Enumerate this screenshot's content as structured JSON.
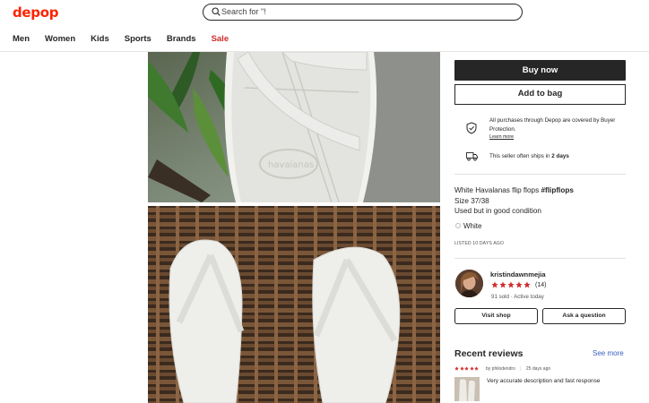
{
  "brand": {
    "logo": "depop",
    "color": "#ff2300"
  },
  "search": {
    "placeholder": "Search for \"!"
  },
  "nav": {
    "items": [
      "Men",
      "Women",
      "Kids",
      "Sports",
      "Brands",
      "Sale"
    ]
  },
  "actions": {
    "buy_now": "Buy now",
    "add_to_bag": "Add to bag"
  },
  "protection": {
    "text": "All purchases through Depop are covered by Buyer Protection.",
    "learn_more": "Learn more",
    "icon": "shield-check-icon"
  },
  "shipping": {
    "prefix": "This seller often ships in ",
    "days": "2 days",
    "icon": "truck-icon"
  },
  "description": {
    "title": "White Havalanas flip flops ",
    "hashtag": "#flipflops",
    "size": "Size 37/38",
    "condition": "Used but in good condition"
  },
  "color": {
    "label": "White"
  },
  "listed": "LISTED 10 DAYS AGO",
  "seller": {
    "name": "kristindawnmejia",
    "rating_count": "(14)",
    "stars": 5,
    "meta": "91 sold · Active today",
    "visit_shop": "Visit shop",
    "ask_question": "Ask a question"
  },
  "reviews": {
    "title": "Recent reviews",
    "see_more": "See more",
    "items": [
      {
        "stars": 5,
        "by": "by philodendro",
        "age": "25 days ago",
        "text": "Very accurate description and fast response"
      }
    ]
  }
}
